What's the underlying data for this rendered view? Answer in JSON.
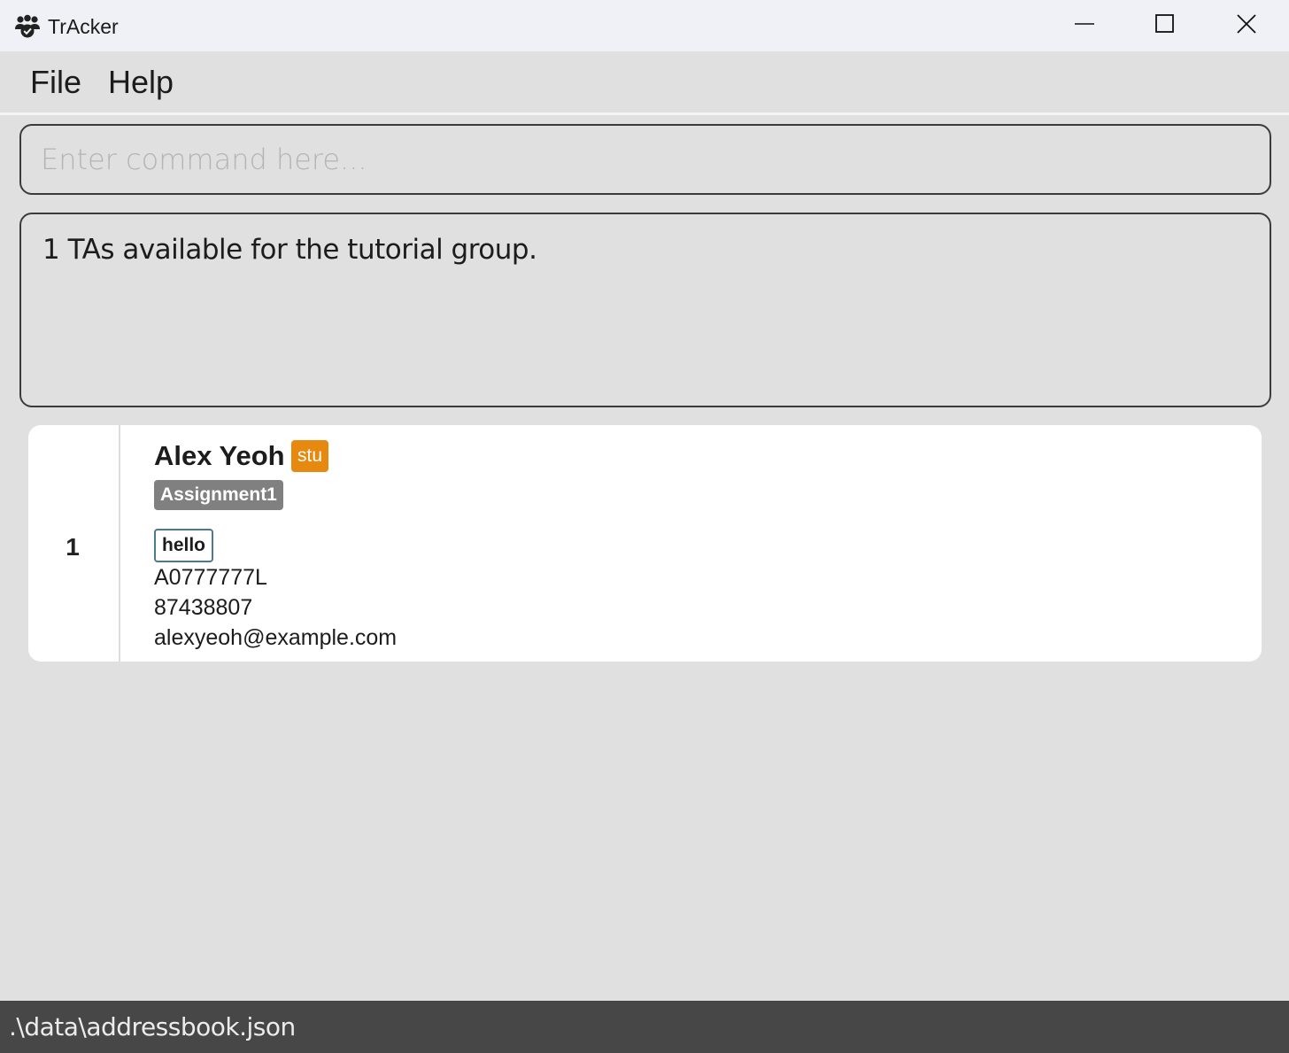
{
  "window": {
    "title": "TrAcker",
    "app_icon": "group-people-icon",
    "controls": {
      "minimize_icon": "minimize-icon",
      "maximize_icon": "maximize-icon",
      "close_icon": "close-icon"
    }
  },
  "menu": {
    "items": [
      {
        "label": "File"
      },
      {
        "label": "Help"
      }
    ]
  },
  "command": {
    "placeholder": "Enter command here...",
    "value": ""
  },
  "result": {
    "message": "1 TAs available for the tutorial group."
  },
  "persons": [
    {
      "index": "1",
      "name": "Alex Yeoh",
      "role": "stu",
      "tags": [
        "Assignment1"
      ],
      "notes": [
        "hello"
      ],
      "student_id": "A0777777L",
      "phone": "87438807",
      "email": "alexyeoh@example.com"
    }
  ],
  "status": {
    "file_path": ".\\data\\addressbook.json"
  },
  "colors": {
    "role_badge": "#e8890f",
    "tag": "#808080",
    "note_border": "#4a7a8c",
    "status_bar": "#474747",
    "background": "#e0e0e0",
    "titlebar": "#f0f1f7"
  }
}
